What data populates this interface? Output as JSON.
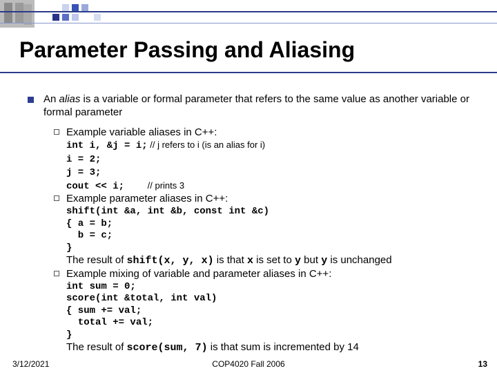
{
  "title": "Parameter Passing and Aliasing",
  "main_bullet": {
    "prefix": "An ",
    "italic": "alias",
    "rest": " is a variable or formal parameter that refers to the same value as another variable or formal parameter"
  },
  "sub": [
    {
      "label": "Example variable aliases in C++:",
      "code": "int i, &j = i;",
      "code_comment": " // j refers to i (is an alias for i)",
      "code_rest": "i = 2;\nj = 3;\ncout << i;    ",
      "code_rest_comment": "// prints 3"
    },
    {
      "label": "Example parameter aliases in C++:",
      "code": "shift(int &a, int &b, const int &c)\n{ a = b;\n  b = c;\n}",
      "result_prefix": "The result of ",
      "result_call": "shift(x, y, x)",
      "result_mid": " is that ",
      "result_x": "x",
      "result_mid2": " is set to ",
      "result_y": "y",
      "result_mid3": " but ",
      "result_y2": "y",
      "result_end": " is unchanged"
    },
    {
      "label": "Example mixing of variable and parameter aliases in C++:",
      "code": "int sum = 0;\nscore(int &total, int val)\n{ sum += val;\n  total += val;\n}",
      "result_prefix": "The result of ",
      "result_call": "score(sum, 7)",
      "result_end": " is that sum is incremented by 14"
    }
  ],
  "footer": {
    "date": "3/12/2021",
    "mid": "COP4020 Fall 2006",
    "page": "13"
  }
}
